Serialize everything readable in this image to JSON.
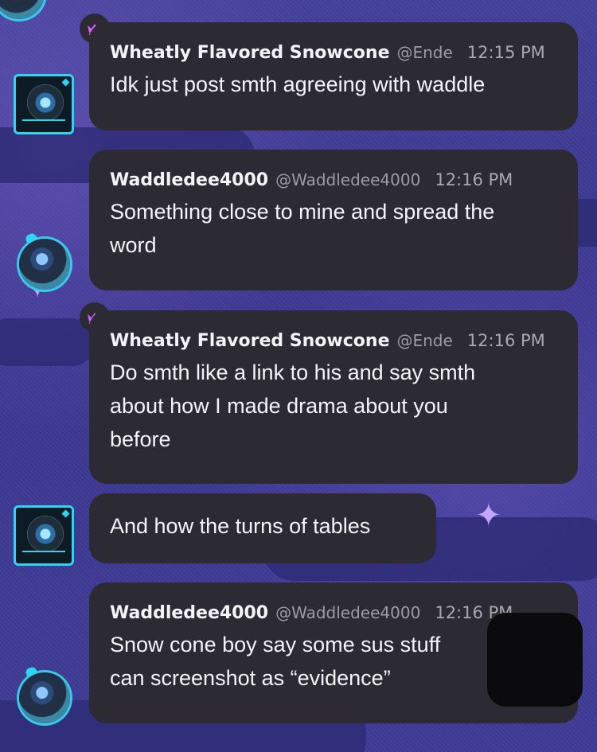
{
  "colors": {
    "bubble_bg": "#2c2b33",
    "name_text": "#f4f4f8",
    "meta_text": "#a9a8b2",
    "crown": "#d45cff",
    "avatar_accent": "#2ed5f1"
  },
  "messages": [
    {
      "author": "Wheatly Flavored Snowcone",
      "handle": "@Ende",
      "time": "12:15 PM",
      "lines": [
        "Idk just post smth agreeing with waddle"
      ]
    },
    {
      "author": "Waddledee4000",
      "handle": "@Waddledee4000",
      "time": "12:16 PM",
      "lines": [
        "Something close to mine and spread the",
        "word"
      ]
    },
    {
      "author": "Wheatly Flavored Snowcone",
      "handle": "@Ende",
      "time": "12:16 PM",
      "lines": [
        "Do smth like a link to his and say smth",
        "about how I made drama about you",
        "before"
      ]
    },
    {
      "lines": [
        "And how the turns of tables"
      ]
    },
    {
      "author": "Waddledee4000",
      "handle": "@Waddledee4000",
      "time": "12:16 PM",
      "lines": [
        "Snow cone boy say some sus stuff",
        "can screenshot as “evidence”"
      ]
    }
  ],
  "icons": {
    "crown": "crown-icon",
    "avatar_snowcone": "avatar-framed",
    "avatar_waddle": "avatar-round"
  }
}
